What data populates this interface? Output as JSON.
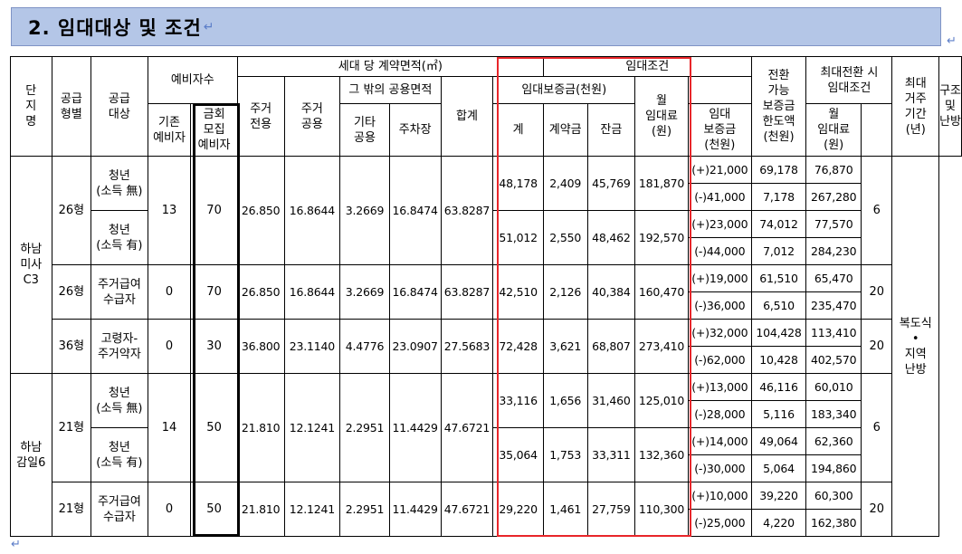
{
  "title": "2. 임대대상 및 조건",
  "headers": {
    "complex": "단\n지\n명",
    "supply_type": "공급\n형별",
    "supply_target": "공급\n대상",
    "reserve_count": "예비자수",
    "reserve_existing": "기존\n예비자",
    "reserve_new": "금회\n모집\n예비자",
    "area_group": "세대 당 계약면적(㎡)",
    "area_exclusive": "주거\n전용",
    "area_common": "주거\n공용",
    "area_other_group": "그 밖의 공용면적",
    "area_other_common": "기타\n공용",
    "area_parking": "주차장",
    "area_total": "합계",
    "lease_group": "임대조건",
    "deposit_group": "임대보증금(천원)",
    "deposit_total": "계",
    "deposit_contract": "계약금",
    "deposit_balance": "잔금",
    "monthly_rent": "월\n임대료\n(원)",
    "convertible": "전환\n가능\n보증금\n한도액\n(천원)",
    "max_conv_group": "최대전환 시\n임대조건",
    "max_conv_deposit": "임대\n보증금\n(천원)",
    "max_conv_rent": "월\n임대료\n(원)",
    "max_residence": "최대\n거주\n기간\n(년)",
    "structure": "구조\n및\n난방"
  },
  "complexes": [
    {
      "name": "하남\n미사\nC3"
    },
    {
      "name": "하남\n감일6"
    }
  ],
  "structure_value": "복도식\n•\n지역\n난방",
  "rows": [
    {
      "type": "26형",
      "target": "청년\n(소득 無)",
      "existing": "13",
      "new": "70",
      "excl": "26.850",
      "comm": "16.8644",
      "other": "3.2669",
      "park": "16.8474",
      "total": "63.8287",
      "dep": "48,178",
      "contract": "2,409",
      "balance": "45,769",
      "rent": "181,870",
      "conv": [
        "(+)21,000",
        "(-)41,000"
      ],
      "mdep": [
        "69,178",
        "7,178"
      ],
      "mrent": [
        "76,870",
        "267,280"
      ],
      "period": "6"
    },
    {
      "target": "청년\n(소득 有)",
      "dep": "51,012",
      "contract": "2,550",
      "balance": "48,462",
      "rent": "192,570",
      "conv": [
        "(+)23,000",
        "(-)44,000"
      ],
      "mdep": [
        "74,012",
        "7,012"
      ],
      "mrent": [
        "77,570",
        "284,230"
      ]
    },
    {
      "type": "26형",
      "target": "주거급여\n수급자",
      "existing": "0",
      "new": "70",
      "excl": "26.850",
      "comm": "16.8644",
      "other": "3.2669",
      "park": "16.8474",
      "total": "63.8287",
      "dep": "42,510",
      "contract": "2,126",
      "balance": "40,384",
      "rent": "160,470",
      "conv": [
        "(+)19,000",
        "(-)36,000"
      ],
      "mdep": [
        "61,510",
        "6,510"
      ],
      "mrent": [
        "65,470",
        "235,470"
      ],
      "period": "20"
    },
    {
      "type": "36형",
      "target": "고령자-\n주거약자",
      "existing": "0",
      "new": "30",
      "excl": "36.800",
      "comm": "23.1140",
      "other": "4.4776",
      "park": "23.0907",
      "total": "27.5683",
      "dep": "72,428",
      "contract": "3,621",
      "balance": "68,807",
      "rent": "273,410",
      "conv": [
        "(+)32,000",
        "(-)62,000"
      ],
      "mdep": [
        "104,428",
        "10,428"
      ],
      "mrent": [
        "113,410",
        "402,570"
      ],
      "period": "20"
    },
    {
      "type": "21형",
      "target": "청년\n(소득 無)",
      "existing": "14",
      "new": "50",
      "excl": "21.810",
      "comm": "12.1241",
      "other": "2.2951",
      "park": "11.4429",
      "total": "47.6721",
      "dep": "33,116",
      "contract": "1,656",
      "balance": "31,460",
      "rent": "125,010",
      "conv": [
        "(+)13,000",
        "(-)28,000"
      ],
      "mdep": [
        "46,116",
        "5,116"
      ],
      "mrent": [
        "60,010",
        "183,340"
      ],
      "period": "6"
    },
    {
      "target": "청년\n(소득 有)",
      "dep": "35,064",
      "contract": "1,753",
      "balance": "33,311",
      "rent": "132,360",
      "conv": [
        "(+)14,000",
        "(-)30,000"
      ],
      "mdep": [
        "49,064",
        "5,064"
      ],
      "mrent": [
        "62,360",
        "194,860"
      ]
    },
    {
      "type": "21형",
      "target": "주거급여\n수급자",
      "existing": "0",
      "new": "50",
      "excl": "21.810",
      "comm": "12.1241",
      "other": "2.2951",
      "park": "11.4429",
      "total": "47.6721",
      "dep": "29,220",
      "contract": "1,461",
      "balance": "27,759",
      "rent": "110,300",
      "conv": [
        "(+)10,000",
        "(-)25,000"
      ],
      "mdep": [
        "39,220",
        "4,220"
      ],
      "mrent": [
        "60,300",
        "162,380"
      ],
      "period": "20"
    }
  ]
}
